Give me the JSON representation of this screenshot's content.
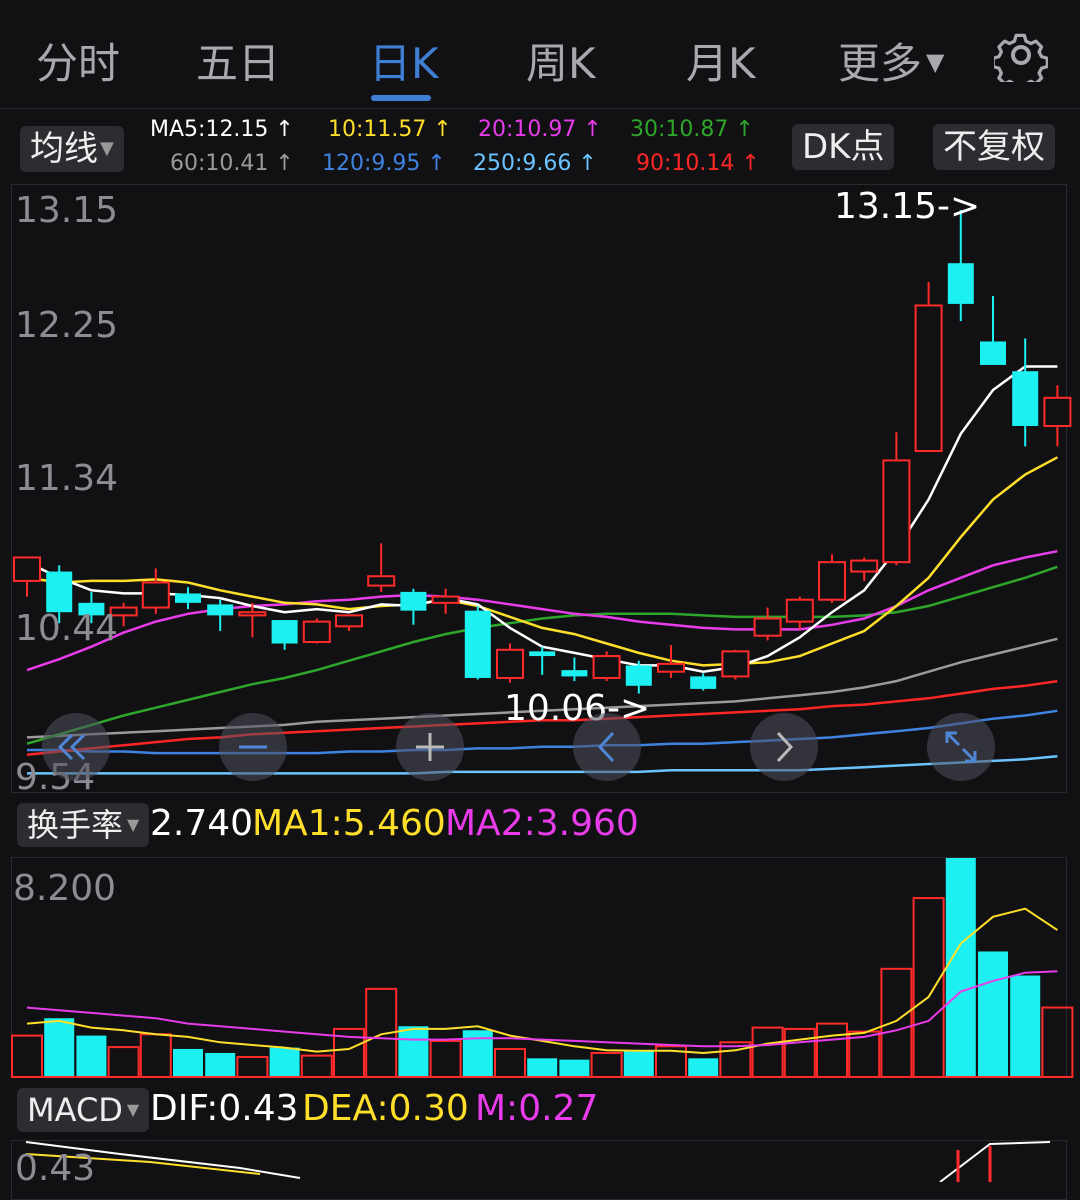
{
  "tabs": [
    {
      "label": "分时",
      "active": false
    },
    {
      "label": "五日",
      "active": false
    },
    {
      "label": "日K",
      "active": true
    },
    {
      "label": "周K",
      "active": false
    },
    {
      "label": "月K",
      "active": false
    },
    {
      "label": "更多",
      "active": false
    }
  ],
  "toolbar": {
    "ma_selector": "均线",
    "dk_button": "DK点",
    "adjust_button": "不复权"
  },
  "ma_values": [
    {
      "label": "MA5:12.15",
      "color": "#ffffff"
    },
    {
      "label": "10:11.57",
      "color": "#ffdf2a"
    },
    {
      "label": "20:10.97",
      "color": "#e83cea"
    },
    {
      "label": "30:10.87",
      "color": "#2ea62b"
    },
    {
      "label": "60:10.41",
      "color": "#9a9a9a"
    },
    {
      "label": "120:9.95",
      "color": "#3f82e0"
    },
    {
      "label": "250:9.66",
      "color": "#6cc4ff"
    },
    {
      "label": "90:10.14",
      "color": "#ff2626"
    }
  ],
  "price_axis": [
    "13.15",
    "12.25",
    "11.34",
    "10.44",
    "9.54"
  ],
  "annotations": {
    "high": "13.15->",
    "low": "10.06->"
  },
  "turnover": {
    "selector": "换手率",
    "value": "2.740",
    "ma1": "MA1:5.460",
    "ma2": "MA2:3.960",
    "axis_max": "8.200"
  },
  "macd": {
    "selector": "MACD",
    "dif": "DIF:0.43",
    "dea": "DEA:0.30",
    "m": "M:0.27",
    "axis_max": "0.43"
  },
  "colors": {
    "up": "#ff2a2a",
    "down": "#1cf0f0",
    "accent": "#3f7fd3",
    "background": "#111113"
  },
  "chart_data": [
    {
      "type": "candlestick",
      "y_axis_ticks": [
        13.15,
        12.25,
        11.34,
        10.44,
        9.54
      ],
      "ylim": [
        9.54,
        13.15
      ],
      "high_marker": 13.15,
      "low_marker": 10.06,
      "candles": [
        {
          "o": 10.78,
          "h": 10.88,
          "l": 10.68,
          "c": 10.93,
          "up": true
        },
        {
          "o": 10.84,
          "h": 10.88,
          "l": 10.51,
          "c": 10.58,
          "up": false
        },
        {
          "o": 10.64,
          "h": 10.71,
          "l": 10.51,
          "c": 10.56,
          "up": false
        },
        {
          "o": 10.56,
          "h": 10.64,
          "l": 10.49,
          "c": 10.61,
          "up": true
        },
        {
          "o": 10.61,
          "h": 10.86,
          "l": 10.57,
          "c": 10.77,
          "up": true
        },
        {
          "o": 10.7,
          "h": 10.74,
          "l": 10.6,
          "c": 10.64,
          "up": false
        },
        {
          "o": 10.63,
          "h": 10.66,
          "l": 10.46,
          "c": 10.56,
          "up": false
        },
        {
          "o": 10.56,
          "h": 10.64,
          "l": 10.42,
          "c": 10.58,
          "up": true
        },
        {
          "o": 10.53,
          "h": 10.53,
          "l": 10.34,
          "c": 10.38,
          "up": false
        },
        {
          "o": 10.39,
          "h": 10.54,
          "l": 10.38,
          "c": 10.52,
          "up": true
        },
        {
          "o": 10.49,
          "h": 10.56,
          "l": 10.46,
          "c": 10.56,
          "up": true
        },
        {
          "o": 10.75,
          "h": 11.02,
          "l": 10.71,
          "c": 10.81,
          "up": true
        },
        {
          "o": 10.71,
          "h": 10.73,
          "l": 10.5,
          "c": 10.59,
          "up": false
        },
        {
          "o": 10.64,
          "h": 10.73,
          "l": 10.57,
          "c": 10.68,
          "up": true
        },
        {
          "o": 10.59,
          "h": 10.62,
          "l": 10.15,
          "c": 10.16,
          "up": false
        },
        {
          "o": 10.16,
          "h": 10.38,
          "l": 10.13,
          "c": 10.34,
          "up": true
        },
        {
          "o": 10.33,
          "h": 10.36,
          "l": 10.18,
          "c": 10.3,
          "up": false
        },
        {
          "o": 10.21,
          "h": 10.29,
          "l": 10.14,
          "c": 10.17,
          "up": false
        },
        {
          "o": 10.16,
          "h": 10.33,
          "l": 10.14,
          "c": 10.3,
          "up": true
        },
        {
          "o": 10.24,
          "h": 10.27,
          "l": 10.06,
          "c": 10.11,
          "up": false
        },
        {
          "o": 10.2,
          "h": 10.37,
          "l": 10.16,
          "c": 10.25,
          "up": true
        },
        {
          "o": 10.17,
          "h": 10.19,
          "l": 10.08,
          "c": 10.09,
          "up": false
        },
        {
          "o": 10.17,
          "h": 10.34,
          "l": 10.15,
          "c": 10.33,
          "up": true
        },
        {
          "o": 10.43,
          "h": 10.61,
          "l": 10.4,
          "c": 10.54,
          "up": true
        },
        {
          "o": 10.52,
          "h": 10.68,
          "l": 10.47,
          "c": 10.66,
          "up": true
        },
        {
          "o": 10.66,
          "h": 10.95,
          "l": 10.64,
          "c": 10.9,
          "up": true
        },
        {
          "o": 10.84,
          "h": 10.93,
          "l": 10.78,
          "c": 10.91,
          "up": true
        },
        {
          "o": 10.9,
          "h": 11.73,
          "l": 10.88,
          "c": 11.55,
          "up": true
        },
        {
          "o": 11.61,
          "h": 12.69,
          "l": 11.61,
          "c": 12.54,
          "up": true
        },
        {
          "o": 12.81,
          "h": 13.15,
          "l": 12.44,
          "c": 12.55,
          "up": false
        },
        {
          "o": 12.31,
          "h": 12.6,
          "l": 12.19,
          "c": 12.16,
          "up": false
        },
        {
          "o": 12.12,
          "h": 12.33,
          "l": 11.64,
          "c": 11.77,
          "up": false
        },
        {
          "o": 11.77,
          "h": 12.03,
          "l": 11.64,
          "c": 11.95,
          "up": true
        }
      ],
      "series": [
        {
          "name": "MA5",
          "color": "#ffffff",
          "values": [
            10.9,
            10.8,
            10.72,
            10.7,
            10.7,
            10.69,
            10.67,
            10.62,
            10.58,
            10.6,
            10.58,
            10.63,
            10.62,
            10.67,
            10.63,
            10.48,
            10.36,
            10.32,
            10.28,
            10.24,
            10.24,
            10.2,
            10.23,
            10.3,
            10.42,
            10.58,
            10.72,
            10.98,
            11.3,
            11.72,
            12.0,
            12.15,
            12.15
          ]
        },
        {
          "name": "MA10",
          "color": "#ffdf2a",
          "values": [
            10.8,
            10.77,
            10.78,
            10.78,
            10.79,
            10.77,
            10.72,
            10.68,
            10.64,
            10.63,
            10.6,
            10.62,
            10.63,
            10.66,
            10.62,
            10.55,
            10.48,
            10.44,
            10.38,
            10.32,
            10.27,
            10.24,
            10.25,
            10.26,
            10.3,
            10.38,
            10.46,
            10.62,
            10.8,
            11.06,
            11.3,
            11.46,
            11.57
          ]
        },
        {
          "name": "MA20",
          "color": "#e83cea",
          "values": [
            10.21,
            10.28,
            10.36,
            10.45,
            10.52,
            10.57,
            10.6,
            10.62,
            10.63,
            10.65,
            10.66,
            10.68,
            10.69,
            10.68,
            10.66,
            10.63,
            10.6,
            10.57,
            10.55,
            10.52,
            10.5,
            10.48,
            10.47,
            10.47,
            10.47,
            10.5,
            10.54,
            10.62,
            10.72,
            10.8,
            10.88,
            10.93,
            10.97
          ]
        },
        {
          "name": "MA30",
          "color": "#2ea62b",
          "values": [
            9.74,
            9.8,
            9.86,
            9.92,
            9.97,
            10.02,
            10.07,
            10.12,
            10.16,
            10.21,
            10.27,
            10.33,
            10.39,
            10.44,
            10.48,
            10.51,
            10.54,
            10.56,
            10.57,
            10.57,
            10.57,
            10.56,
            10.55,
            10.55,
            10.55,
            10.55,
            10.56,
            10.58,
            10.62,
            10.68,
            10.74,
            10.8,
            10.87
          ]
        },
        {
          "name": "MA60",
          "color": "#9a9a9a",
          "values": [
            9.78,
            9.79,
            9.8,
            9.81,
            9.82,
            9.83,
            9.84,
            9.85,
            9.86,
            9.88,
            9.89,
            9.9,
            9.91,
            9.92,
            9.93,
            9.94,
            9.95,
            9.96,
            9.97,
            9.98,
            9.99,
            10.0,
            10.01,
            10.03,
            10.05,
            10.07,
            10.1,
            10.14,
            10.2,
            10.26,
            10.31,
            10.36,
            10.41
          ]
        },
        {
          "name": "MA90",
          "color": "#ff2626",
          "values": [
            9.67,
            9.69,
            9.71,
            9.73,
            9.75,
            9.77,
            9.78,
            9.8,
            9.81,
            9.82,
            9.83,
            9.84,
            9.85,
            9.86,
            9.87,
            9.88,
            9.89,
            9.89,
            9.9,
            9.91,
            9.92,
            9.93,
            9.94,
            9.95,
            9.96,
            9.98,
            9.99,
            10.01,
            10.03,
            10.06,
            10.09,
            10.11,
            10.14
          ]
        },
        {
          "name": "MA120",
          "color": "#3f82e0",
          "values": [
            9.7,
            9.7,
            9.69,
            9.69,
            9.68,
            9.68,
            9.68,
            9.68,
            9.68,
            9.68,
            9.69,
            9.69,
            9.7,
            9.7,
            9.71,
            9.71,
            9.72,
            9.72,
            9.73,
            9.73,
            9.74,
            9.74,
            9.75,
            9.76,
            9.77,
            9.78,
            9.8,
            9.82,
            9.84,
            9.87,
            9.9,
            9.92,
            9.95
          ]
        },
        {
          "name": "MA250",
          "color": "#6cc4ff",
          "values": [
            9.55,
            9.55,
            9.55,
            9.55,
            9.55,
            9.55,
            9.55,
            9.55,
            9.55,
            9.55,
            9.55,
            9.55,
            9.55,
            9.56,
            9.56,
            9.56,
            9.56,
            9.56,
            9.56,
            9.56,
            9.57,
            9.57,
            9.57,
            9.57,
            9.57,
            9.58,
            9.59,
            9.6,
            9.61,
            9.62,
            9.63,
            9.64,
            9.66
          ]
        }
      ]
    },
    {
      "type": "bar",
      "name": "换手率",
      "ylim": [
        0,
        8.2
      ],
      "values": [
        1.55,
        2.2,
        1.55,
        1.12,
        1.6,
        1.05,
        0.9,
        0.75,
        1.1,
        0.8,
        1.8,
        3.3,
        1.9,
        1.35,
        1.75,
        1.05,
        0.7,
        0.65,
        0.9,
        1.0,
        1.15,
        0.7,
        1.3,
        1.85,
        1.8,
        2.0,
        1.7,
        4.05,
        6.7,
        8.2,
        4.7,
        3.8,
        2.6
      ],
      "up": [
        true,
        false,
        false,
        true,
        true,
        false,
        false,
        true,
        false,
        true,
        true,
        true,
        false,
        true,
        false,
        true,
        false,
        false,
        true,
        false,
        true,
        false,
        true,
        true,
        true,
        true,
        true,
        true,
        true,
        false,
        false,
        false,
        true
      ],
      "series": [
        {
          "name": "MA1",
          "color": "#ffdf2a",
          "values": [
            2.0,
            2.1,
            1.85,
            1.75,
            1.6,
            1.5,
            1.3,
            1.2,
            1.1,
            0.95,
            1.05,
            1.6,
            1.8,
            1.8,
            1.9,
            1.55,
            1.35,
            1.15,
            1.0,
            0.98,
            0.98,
            0.9,
            1.0,
            1.25,
            1.4,
            1.55,
            1.65,
            2.1,
            3.0,
            5.0,
            6.0,
            6.3,
            5.5
          ]
        },
        {
          "name": "MA2",
          "color": "#e83cea",
          "values": [
            2.6,
            2.5,
            2.4,
            2.3,
            2.2,
            2.0,
            1.9,
            1.8,
            1.7,
            1.6,
            1.5,
            1.45,
            1.4,
            1.4,
            1.45,
            1.45,
            1.4,
            1.35,
            1.3,
            1.25,
            1.2,
            1.15,
            1.15,
            1.2,
            1.3,
            1.4,
            1.5,
            1.75,
            2.1,
            3.2,
            3.6,
            3.9,
            3.96
          ]
        }
      ]
    }
  ]
}
